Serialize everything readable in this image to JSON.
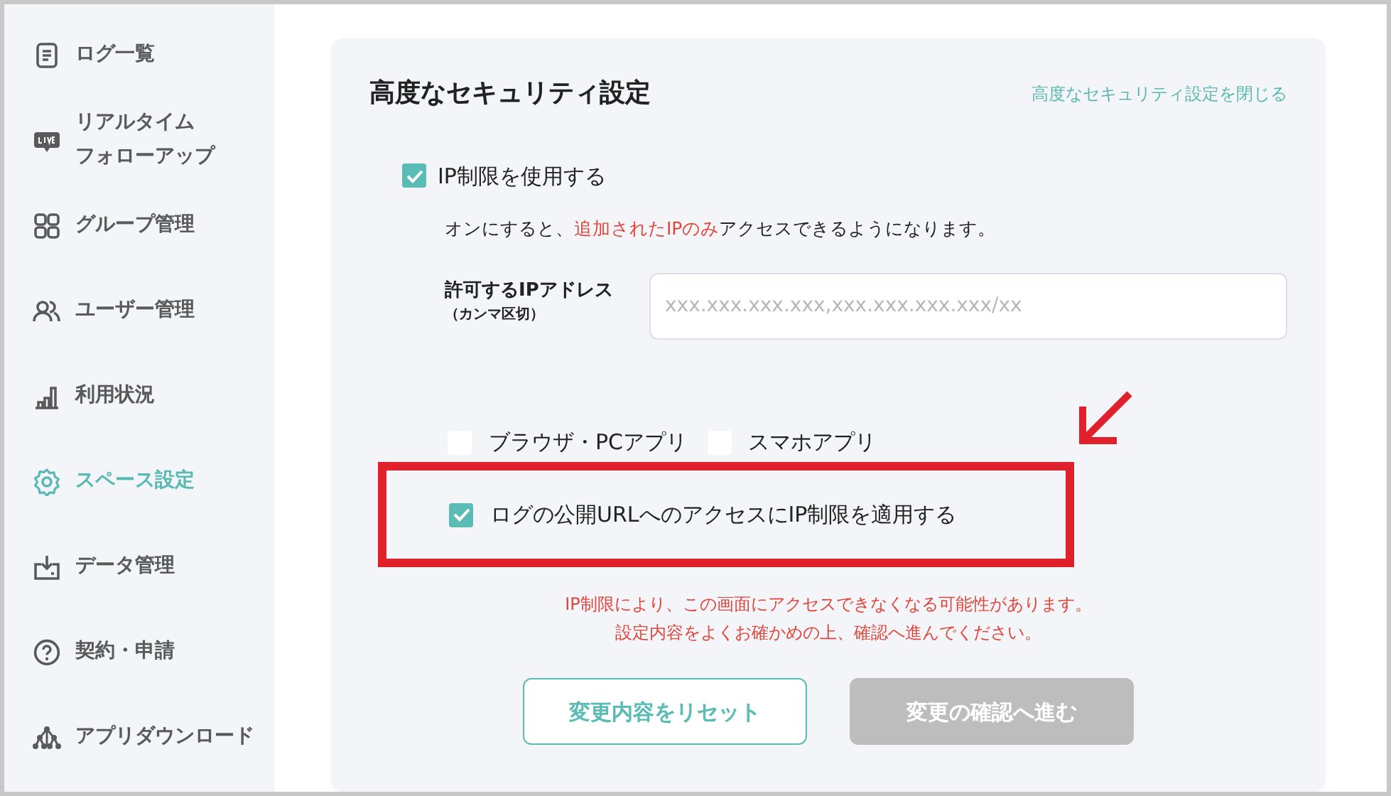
{
  "sidebar": {
    "items": [
      {
        "label": "ログ一覧",
        "selected": false
      },
      {
        "label": [
          "リアルタイム",
          "フォローアップ"
        ],
        "selected": false
      },
      {
        "label": "グループ管理",
        "selected": false
      },
      {
        "label": "ユーザー管理",
        "selected": false
      },
      {
        "label": "利用状況",
        "selected": false
      },
      {
        "label": "スペース設定",
        "selected": true
      },
      {
        "label": "データ管理",
        "selected": false
      },
      {
        "label": "契約・申請",
        "selected": false
      },
      {
        "label": "アプリダウンロード",
        "selected": false
      }
    ]
  },
  "panel": {
    "title": "高度なセキュリティ設定",
    "close_link": "高度なセキュリティ設定を閉じる",
    "ip_restriction": {
      "label": "IP制限を使用する",
      "checked": true
    },
    "description": [
      {
        "text": "オンにすると、",
        "emphasis": false
      },
      {
        "text": "追加されたIPのみ",
        "emphasis": true
      },
      {
        "text": "アクセスできるようになります。",
        "emphasis": false
      }
    ],
    "ip_field": {
      "label": "許可するIPアドレス",
      "note": "（カンマ区切）",
      "placeholder": "xxx.xxx.xxx.xxx,xxx.xxx.xxx.xxx/xx"
    },
    "targets": [
      {
        "label": "ブラウザ・PCアプリ",
        "checked": false
      },
      {
        "label": "スマホアプリ",
        "checked": false
      }
    ],
    "public_url": {
      "label": "ログの公開URLへのアクセスにIP制限を適用する",
      "checked": true,
      "annotated": true
    },
    "warning": [
      "IP制限により、この画面にアクセスできなくなる可能性があります。",
      "設定内容をよくお確かめの上、確認へ進んでください。"
    ],
    "buttons": [
      {
        "label": "変更内容をリセット",
        "kind": "outline",
        "disabled": false
      },
      {
        "label": "変更の確認へ進む",
        "kind": "primary",
        "disabled": true
      }
    ]
  }
}
